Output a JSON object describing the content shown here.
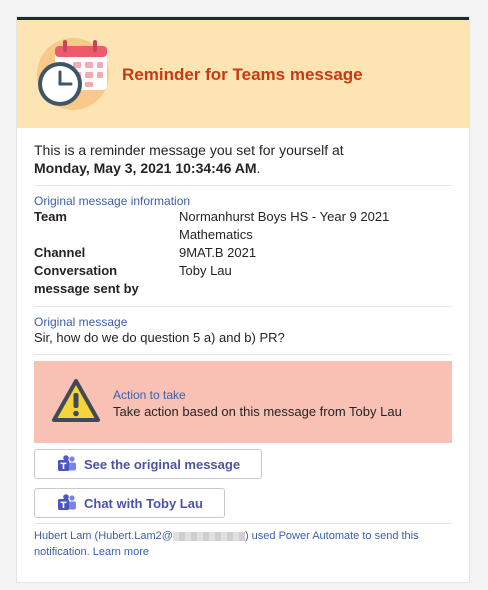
{
  "header": {
    "title": "Reminder for Teams message",
    "icon": "calendar-clock-icon"
  },
  "intro": {
    "text": "This is a reminder message you set for yourself at",
    "date": "Monday, May 3, 2021 10:34:46 AM",
    "suffix": "."
  },
  "info": {
    "heading": "Original message information",
    "rows": [
      {
        "key": "Team",
        "value": "Normanhurst Boys HS - Year 9 2021 Mathematics"
      },
      {
        "key": "Channel",
        "value": "9MAT.B 2021"
      },
      {
        "key": "Conversation message sent by",
        "value": "Toby Lau"
      }
    ]
  },
  "message": {
    "heading": "Original message",
    "text": "Sir, how do we do question 5 a) and b) PR?"
  },
  "action": {
    "label": "Action to take",
    "text": "Take action based on this message from Toby Lau",
    "icon": "warning-icon"
  },
  "buttons": {
    "see_original": "See the original message",
    "chat": "Chat with Toby Lau"
  },
  "footer": {
    "sender": "Hubert Lam (Hubert.Lam2@",
    "after": ") used Power Automate to send this notification.",
    "learn_more": "Learn more"
  },
  "colors": {
    "header_bg": "#fde4b3",
    "title": "#c83a10",
    "action_bg": "#f9c1b4",
    "link": "#3b5fad",
    "button_text": "#4b53a8"
  }
}
